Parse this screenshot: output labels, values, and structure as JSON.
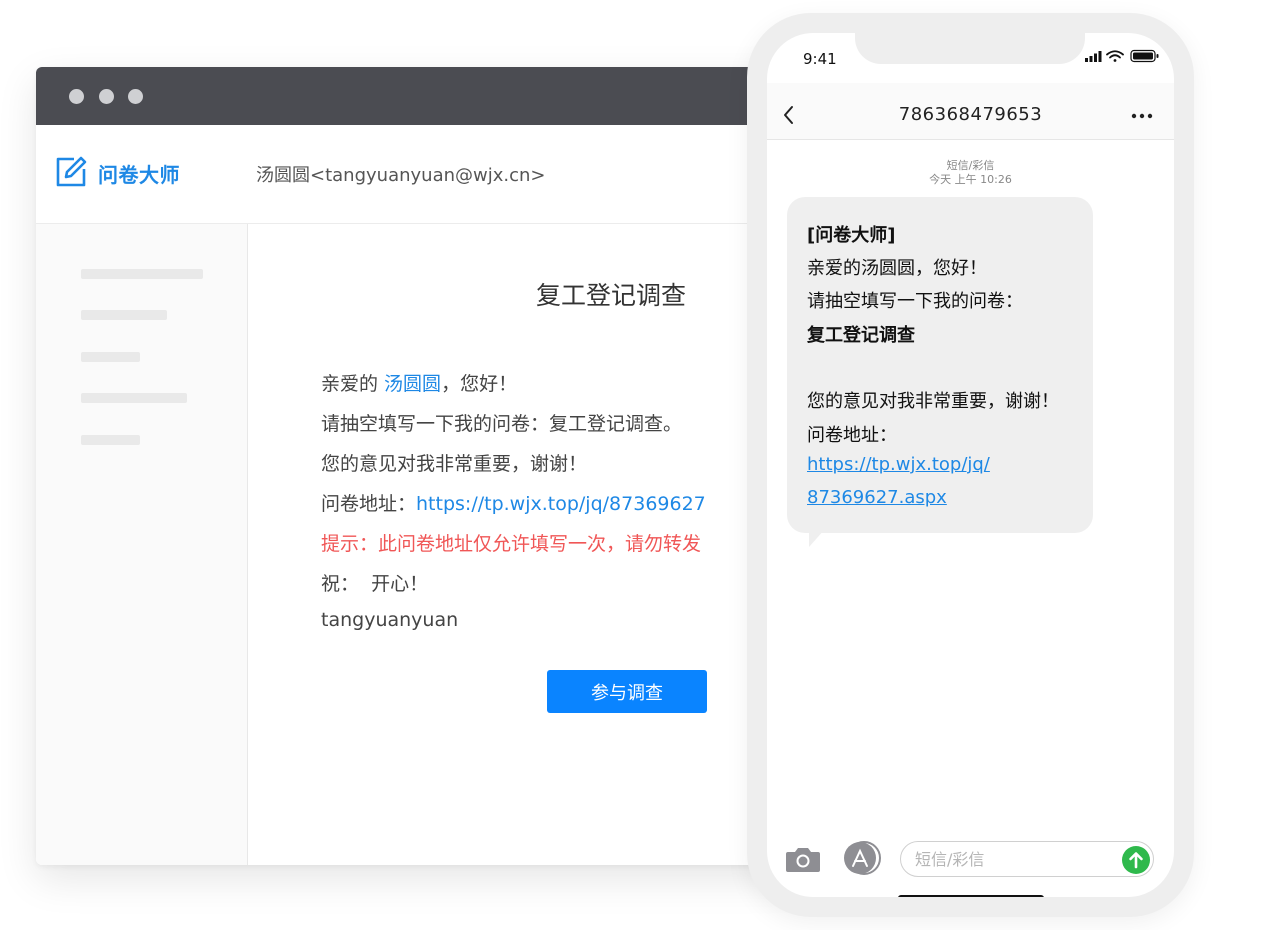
{
  "mail": {
    "brand": "问卷大师",
    "sender": "汤圆圆<tangyuanyuan@wjx.cn>",
    "title": "复工登记调查",
    "greeting_prefix": "亲爱的 ",
    "greeting_name": "汤圆圆",
    "greeting_suffix": "，您好！",
    "line_invite": "请抽空填写一下我的问卷：复工登记调查。",
    "line_thanks": "您的意见对我非常重要，谢谢！",
    "link_label": "问卷地址：",
    "link_url": "https://tp.wjx.top/jq/87369627",
    "tip": "提示：此问卷地址仅允许填写一次，请勿转发",
    "wish": "祝：  开心！",
    "signature": "tangyuanyuan",
    "join_button": "参与调查"
  },
  "phone": {
    "time": "9:41",
    "contact": "786368479653",
    "message_type": "短信/彩信",
    "message_time": "今天 上午 10:26",
    "sms": {
      "l1": "[问卷大师]",
      "l2": "亲爱的汤圆圆，您好！",
      "l3": "请抽空填写一下我的问卷：",
      "l4": "复工登记调查",
      "l5": "您的意见对我非常重要，谢谢！",
      "l6": "问卷地址：",
      "link1": "https://tp.wjx.top/jq/",
      "link2": "87369627.aspx"
    },
    "input_placeholder": "短信/彩信"
  },
  "colors": {
    "accent_blue": "#1e88e5",
    "button_blue": "#0a84ff",
    "warning_red": "#f05656",
    "titlebar": "#4b4c52",
    "send_green": "#2fb94c"
  },
  "icons": [
    "edit-icon",
    "back-icon",
    "more-icon",
    "camera-icon",
    "app-store-icon",
    "send-icon",
    "signal-icon",
    "wifi-icon",
    "battery-icon"
  ]
}
